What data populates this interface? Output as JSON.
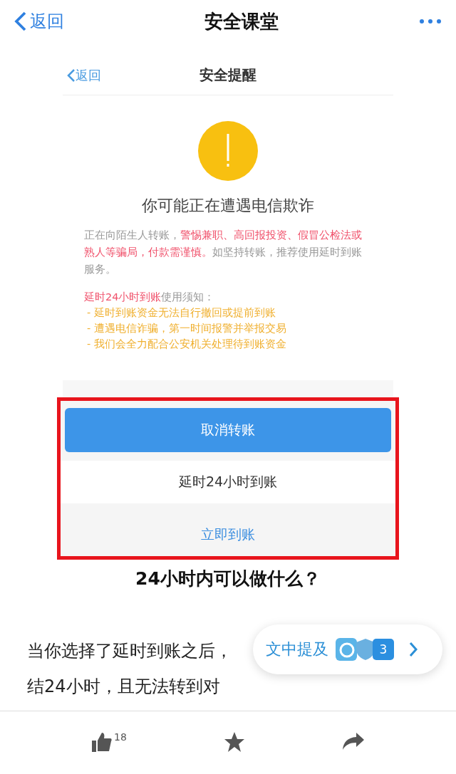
{
  "nav": {
    "back": "返回",
    "title": "安全课堂"
  },
  "screenshot": {
    "nav": {
      "back": "返回",
      "title": "安全提醒"
    },
    "heading": "你可能正在遭遇电信欺诈",
    "body": [
      {
        "text": "正在向陌生人转账，",
        "kind": "plain"
      },
      {
        "text": "警惕兼职、高回报投资、假冒公检法或熟人等骗局，付款需谨慎。",
        "kind": "warning"
      },
      {
        "text": "如坚持转账，推荐使用延时到账服务。",
        "kind": "plain"
      }
    ],
    "notice_title": [
      {
        "text": "延时24小时到账",
        "kind": "warning"
      },
      {
        "text": "使用须知：",
        "kind": "plain"
      }
    ],
    "notice_items": [
      "- 延时到账资金无法自行撤回或提前到账",
      "- 遭遇电信诈骗，第一时间报警并举报交易",
      "- 我们会全力配合公安机关处理待到账资金"
    ],
    "buttons_highlighted": true,
    "buttons": [
      {
        "label": "取消转账",
        "kind": "primary"
      },
      {
        "label": "延时24小时到账",
        "kind": "plain"
      },
      {
        "label": "立即到账",
        "kind": "link"
      }
    ]
  },
  "caption": "24小时内可以做什么？",
  "article_lines": [
    "当你选择了延时到账之后，",
    "结24小时，且无法转到对"
  ],
  "mentions": {
    "label": "文中提及",
    "count": "3"
  },
  "footer": {
    "likes": "18"
  }
}
